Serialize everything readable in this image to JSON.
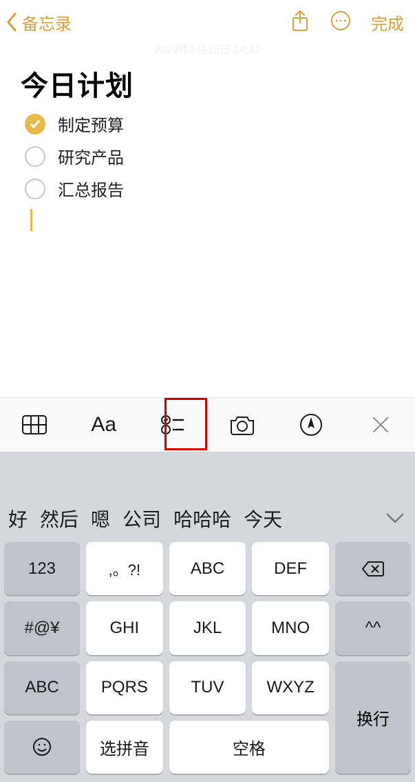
{
  "nav": {
    "back_label": "备忘录",
    "done_label": "完成"
  },
  "date_line": "2023年5月15日 14:32",
  "note": {
    "title": "今日计划",
    "items": [
      {
        "text": "制定预算",
        "checked": true
      },
      {
        "text": "研究产品",
        "checked": false
      },
      {
        "text": "汇总报告",
        "checked": false
      }
    ]
  },
  "format_bar": {
    "aa_label": "Aa"
  },
  "suggestions": [
    "好",
    "然后",
    "嗯",
    "公司",
    "哈哈哈",
    "今天"
  ],
  "keypad": {
    "r1": [
      "123",
      ",。?!",
      "ABC",
      "DEF"
    ],
    "r2": [
      "#@¥",
      "GHI",
      "JKL",
      "MNO",
      "^^"
    ],
    "r3": [
      "ABC",
      "PQRS",
      "TUV",
      "WXYZ"
    ],
    "r4_select": "选拼音",
    "r4_space": "空格",
    "enter": "换行"
  }
}
